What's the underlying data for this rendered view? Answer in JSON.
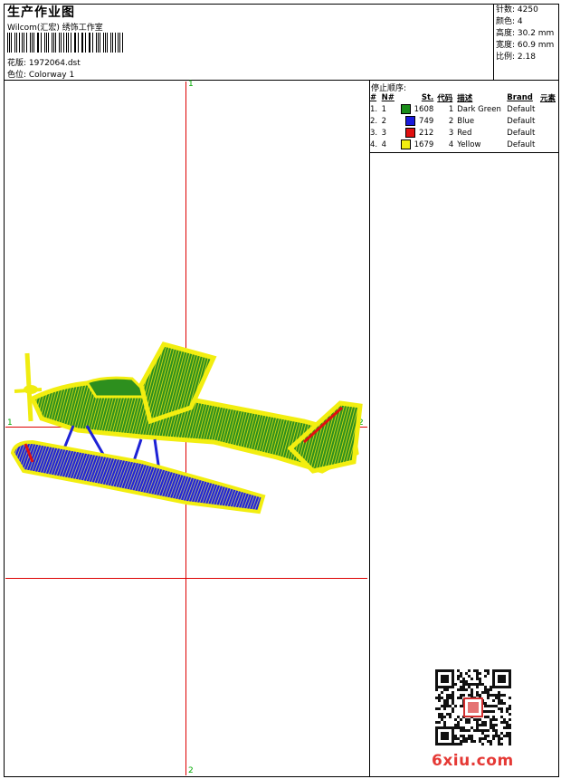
{
  "header": {
    "title": "生产作业图",
    "company": "Wilcom(汇宏) 绣饰工作室",
    "design_label": "花版: 1972064.dst",
    "colorway_label": "色位: Colorway 1"
  },
  "stats": {
    "stitches": "针数: 4250",
    "colors": "颜色: 4",
    "height": "高度: 30.2 mm",
    "width": "宽度: 60.9 mm",
    "ratio": "比例: 2.18"
  },
  "stop_sequence": {
    "title": "停止顺序:",
    "headers": [
      "#",
      "N#",
      "St.",
      "代码",
      "描述",
      "Brand",
      "元素"
    ],
    "rows": [
      {
        "num": "1.",
        "n": "1",
        "st": "1608",
        "code": "1",
        "desc": "Dark Green",
        "brand": "Default",
        "color": "#1a8c1a"
      },
      {
        "num": "2.",
        "n": "2",
        "st": "749",
        "code": "2",
        "desc": "Blue",
        "brand": "Default",
        "color": "#1a1adc"
      },
      {
        "num": "3.",
        "n": "3",
        "st": "212",
        "code": "3",
        "desc": "Red",
        "brand": "Default",
        "color": "#e01010"
      },
      {
        "num": "4.",
        "n": "4",
        "st": "1679",
        "code": "4",
        "desc": "Yellow",
        "brand": "Default",
        "color": "#f2ee10"
      }
    ]
  },
  "markers": {
    "top": "1",
    "bottom": "2",
    "left": "1",
    "right": "2"
  },
  "footer": {
    "site": "6xiu.com"
  }
}
